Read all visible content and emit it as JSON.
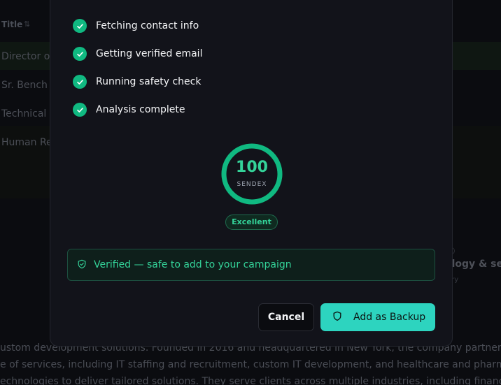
{
  "background": {
    "table_header": {
      "title": "Title",
      "sort_icon": "sort-icon"
    },
    "rows": [
      "Director of",
      "Sr. Bench S",
      "Technical R",
      "Human Res"
    ],
    "company": {
      "title_fragment": "ology & se",
      "subtitle_fragment": "stry"
    },
    "description_lines": [
      "ustom development solutions. Founded in 2016 and headquartered in New York, the company partners with F",
      "e of services, including IT staffing and recruitment, custom IT development, and healthcare and pharmaceutic",
      "echnologies to deliver tailored solutions. They serve clients across multiple industries, including finance, edu"
    ]
  },
  "modal": {
    "steps": [
      {
        "label": "Fetching contact info",
        "icon": "check-icon"
      },
      {
        "label": "Getting verified email",
        "icon": "check-icon"
      },
      {
        "label": "Running safety check",
        "icon": "check-icon"
      },
      {
        "label": "Analysis complete",
        "icon": "check-icon"
      }
    ],
    "score": {
      "value": "100",
      "label": "SENDEX",
      "fraction": 1.0
    },
    "rating_badge": "Excellent",
    "verified": {
      "text": "Verified — safe to add to your campaign",
      "icon": "shield-check-icon"
    },
    "buttons": {
      "cancel": "Cancel",
      "add": "Add as Backup",
      "add_icon": "shield-icon"
    }
  },
  "colors": {
    "accent": "#10b981",
    "accent_text": "#34d399",
    "button": "#2dd4bf"
  }
}
